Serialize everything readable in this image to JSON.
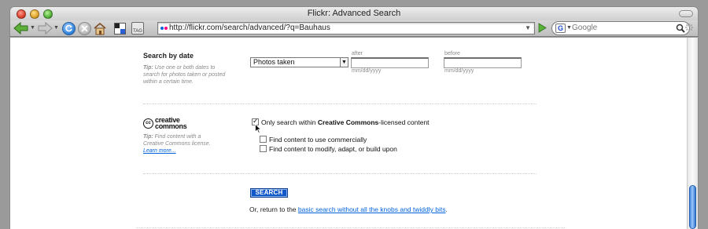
{
  "window": {
    "title": "Flickr: Advanced Search"
  },
  "toolbar": {
    "url": "http://flickr.com/search/advanced/?q=Bauhaus",
    "search_placeholder": "Google",
    "tag_label": "TAG"
  },
  "date_section": {
    "heading": "Search by date",
    "tip_label": "Tip:",
    "tip_text": " Use one or both dates to search for photos taken or posted within a certain time.",
    "select_value": "Photos taken",
    "after_label": "after",
    "before_label": "before",
    "after_value": "",
    "before_value": "",
    "after_format": "mm/dd/yyyy",
    "before_format": "mm/dd/yyyy"
  },
  "cc_section": {
    "logo_line1": "creative",
    "logo_line2": "commons",
    "logo_badge": "cc",
    "tip_label": "Tip:",
    "tip_text": " Find content with a Creative Commons license.",
    "learn_more": "Learn more...",
    "only_cc_prefix": "Only search within ",
    "only_cc_bold": "Creative Commons",
    "only_cc_suffix": "-licensed content",
    "only_cc_checked": true,
    "commercial_label": "Find content to use commercially",
    "commercial_checked": false,
    "modify_label": "Find content to modify, adapt, or build upon",
    "modify_checked": false
  },
  "actions": {
    "search_button": "SEARCH",
    "return_prefix": "Or, return to the ",
    "return_link": "basic search without all the knobs and twiddly bits",
    "return_suffix": "."
  },
  "colors": {
    "link": "#0063dc",
    "search_button": "#1057c9",
    "tip_text": "#8a8a8a"
  }
}
